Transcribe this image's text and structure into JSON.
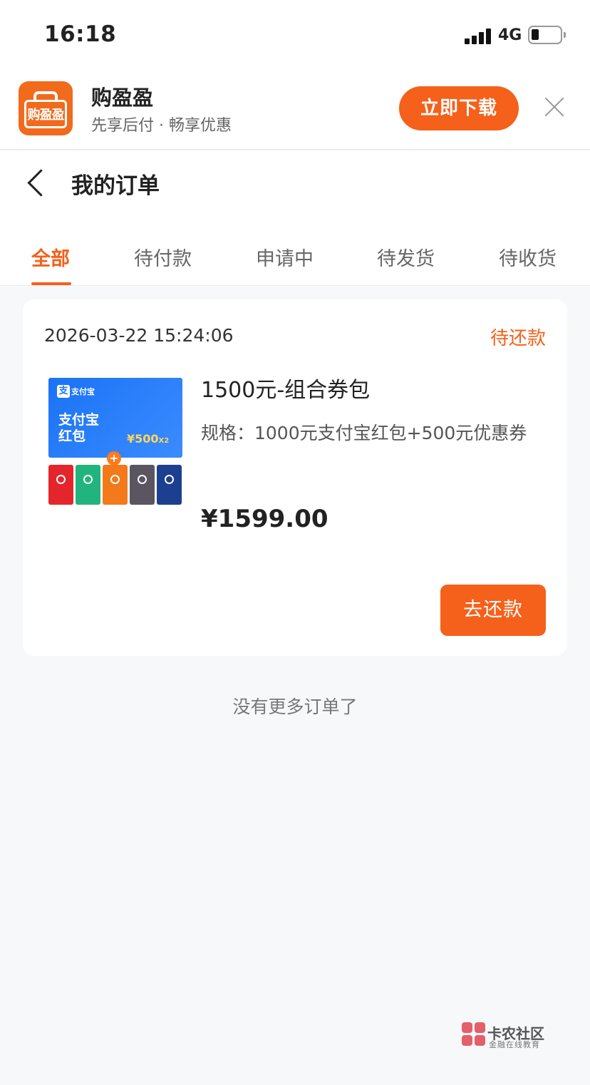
{
  "status_bar": {
    "time": "16:18",
    "network": "4G"
  },
  "app_banner": {
    "logo_text": "购盈盈",
    "name": "购盈盈",
    "slogan": "先享后付 · 畅享优惠",
    "download_label": "立即下载"
  },
  "nav": {
    "title": "我的订单"
  },
  "tabs": [
    {
      "label": "全部",
      "active": true
    },
    {
      "label": "待付款"
    },
    {
      "label": "申请中"
    },
    {
      "label": "待发货"
    },
    {
      "label": "待收货"
    }
  ],
  "order": {
    "time": "2026-03-22 15:24:06",
    "status": "待还款",
    "thumbnail": {
      "brand": "支付宝",
      "title_line1": "支付宝",
      "title_line2": "红包",
      "amount": "¥500",
      "multiplier": "X2",
      "tile_colors": [
        "#e4262c",
        "#22b47f",
        "#f27a1b",
        "#5a5560",
        "#1d3f8f"
      ]
    },
    "product_name": "1500元-组合券包",
    "spec": "规格：1000元支付宝红包+500元优惠券",
    "price": "¥1599.00",
    "action_label": "去还款"
  },
  "footer_text": "没有更多订单了",
  "watermark": {
    "title": "卡农社区",
    "subtitle": "金融在线教育"
  },
  "colors": {
    "accent": "#f5601a",
    "background": "#f7f8fa"
  }
}
